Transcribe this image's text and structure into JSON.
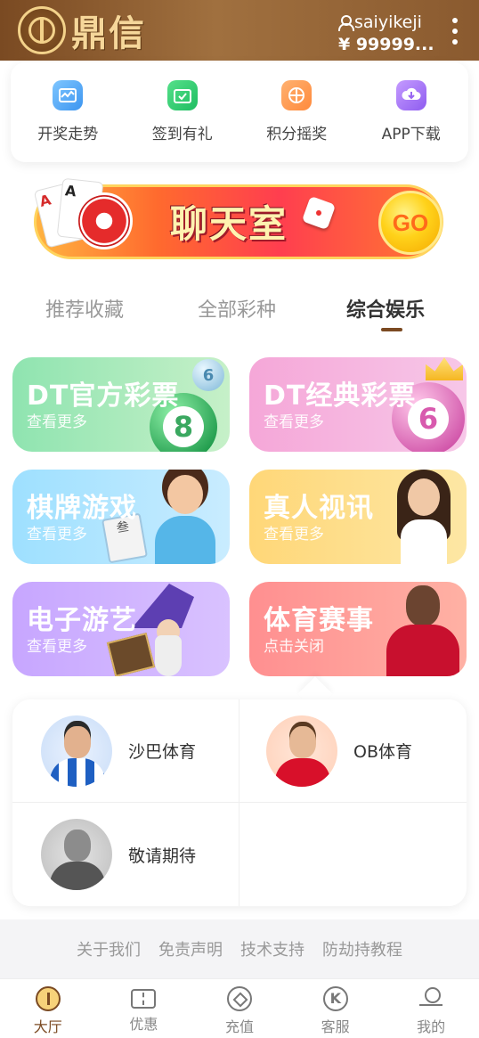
{
  "header": {
    "brand": "鼎信",
    "username": "saiyikeji",
    "balance": "¥ 99999..."
  },
  "quick_actions": [
    {
      "label": "开奖走势",
      "icon": "trend-chart-icon"
    },
    {
      "label": "签到有礼",
      "icon": "calendar-check-icon"
    },
    {
      "label": "积分摇奖",
      "icon": "lottery-wheel-icon"
    },
    {
      "label": "APP下载",
      "icon": "cloud-download-icon"
    }
  ],
  "banner": {
    "title": "聊天室",
    "go": "GO"
  },
  "tabs": [
    {
      "label": "推荐收藏",
      "active": false
    },
    {
      "label": "全部彩种",
      "active": false
    },
    {
      "label": "综合娱乐",
      "active": true
    }
  ],
  "categories": [
    {
      "title": "DT官方彩票",
      "subtitle": "查看更多",
      "ball_number": "8",
      "small_ball": "6"
    },
    {
      "title": "DT经典彩票",
      "subtitle": "查看更多",
      "ball_number": "6"
    },
    {
      "title": "棋牌游戏",
      "subtitle": "查看更多",
      "tile": "叁"
    },
    {
      "title": "真人视讯",
      "subtitle": "查看更多"
    },
    {
      "title": "电子游艺",
      "subtitle": "查看更多"
    },
    {
      "title": "体育赛事",
      "subtitle": "点击关闭"
    }
  ],
  "sports": [
    {
      "label": "沙巴体育"
    },
    {
      "label": "OB体育"
    },
    {
      "label": "敬请期待"
    }
  ],
  "footer_links": [
    "关于我们",
    "免责声明",
    "技术支持",
    "防劫持教程"
  ],
  "bottom_nav": [
    {
      "label": "大厅",
      "icon": "home-icon",
      "active": true
    },
    {
      "label": "优惠",
      "icon": "ticket-icon",
      "active": false
    },
    {
      "label": "充值",
      "icon": "coin-icon",
      "active": false
    },
    {
      "label": "客服",
      "icon": "service-icon",
      "active": false
    },
    {
      "label": "我的",
      "icon": "profile-icon",
      "active": false
    }
  ],
  "colors": {
    "brand_brown": "#7b4a22",
    "header_gold": "#f6d79a",
    "banner_orange": "#ff6a2e",
    "go_yellow": "#ffd21a"
  }
}
